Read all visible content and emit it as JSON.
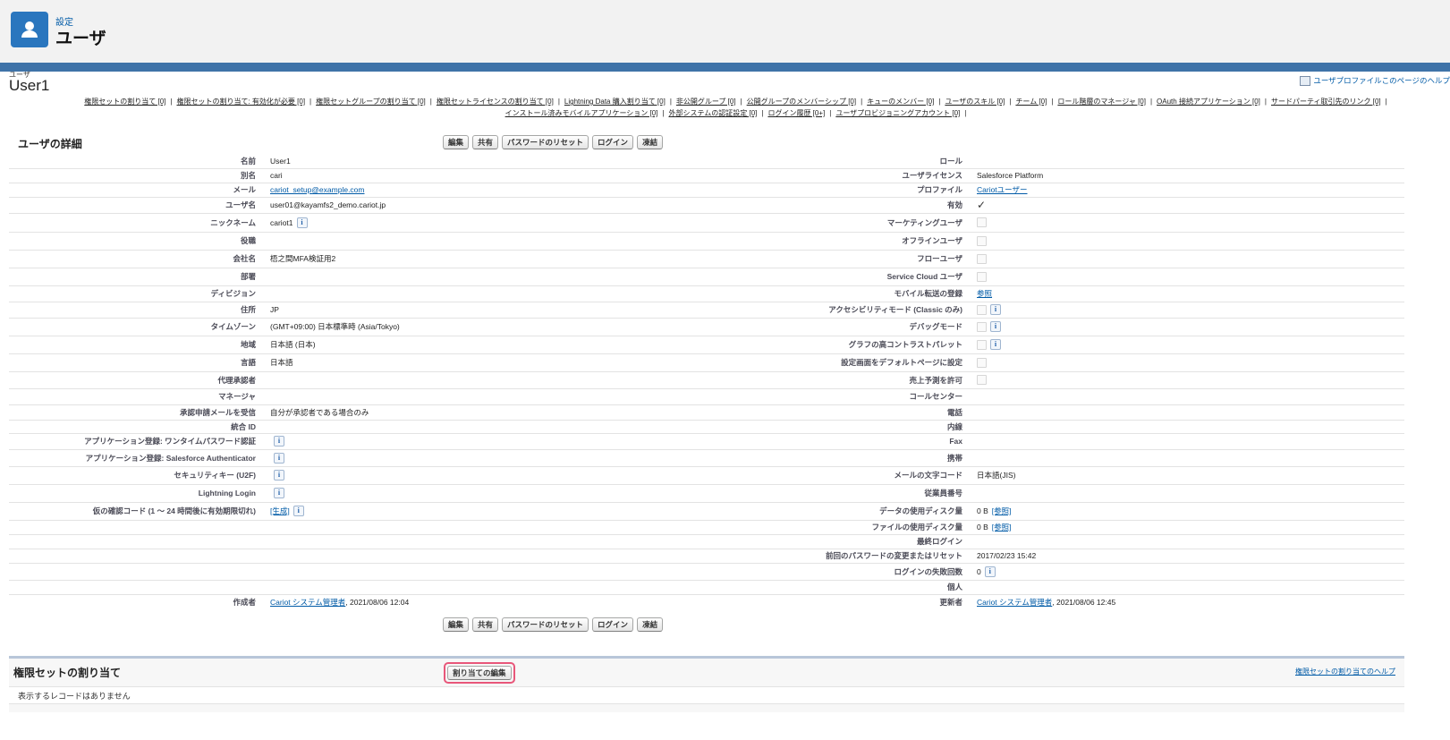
{
  "header": {
    "breadcrumb": "設定",
    "title": "ユーザ",
    "icon": "user-icon"
  },
  "user_header": {
    "small_label": "ユーザ",
    "name": "User1",
    "help_link": "ユーザプロファイルこのページのヘルプ"
  },
  "related_links_row1": [
    "権限セットの割り当て [0]",
    "権限セットの割り当て: 有効化が必要 [0]",
    "権限セットグループの割り当て [0]",
    "権限セットライセンスの割り当て [0]",
    "Lightning Data 購入割り当て [0]",
    "非公開グループ [0]",
    "公開グループのメンバーシップ [0]",
    "キューのメンバー [0]",
    "ユーザのスキル [0]",
    "チーム [0]",
    "ロール階層のマネージャ [0]",
    "OAuth 接続アプリケーション [0]",
    "サードパーティ取引先のリンク [0]"
  ],
  "related_links_row2": [
    "インストール済みモバイルアプリケーション [0]",
    "外部システムの認証設定 [0]",
    "ログイン履歴 [0+]",
    "ユーザプロビジョニングアカウント [0]"
  ],
  "detail": {
    "title": "ユーザの詳細",
    "buttons": [
      "編集",
      "共有",
      "パスワードのリセット",
      "ログイン",
      "凍結"
    ]
  },
  "left_fields": [
    {
      "label": "名前",
      "value": "User1"
    },
    {
      "label": "別名",
      "value": "cari"
    },
    {
      "label": "メール",
      "value": "cariot_setup@example.com",
      "link": true
    },
    {
      "label": "ユーザ名",
      "value": "user01@kayamfs2_demo.cariot.jp"
    },
    {
      "label": "ニックネーム",
      "value": "cariot1",
      "info": true
    },
    {
      "label": "役職",
      "value": ""
    },
    {
      "label": "会社名",
      "value": "梧之間MFA検証用2"
    },
    {
      "label": "部署",
      "value": ""
    },
    {
      "label": "ディビジョン",
      "value": ""
    },
    {
      "label": "住所",
      "value": "JP"
    },
    {
      "label": "タイムゾーン",
      "value": "(GMT+09:00) 日本標準時 (Asia/Tokyo)"
    },
    {
      "label": "地域",
      "value": "日本語 (日本)"
    },
    {
      "label": "言語",
      "value": "日本語"
    },
    {
      "label": "代理承認者",
      "value": ""
    },
    {
      "label": "マネージャ",
      "value": ""
    },
    {
      "label": "承認申請メールを受信",
      "value": "自分が承認者である場合のみ"
    },
    {
      "label": "統合 ID",
      "value": ""
    },
    {
      "label": "アプリケーション登録: ワンタイムパスワード認証",
      "value": "",
      "info": true
    },
    {
      "label": "アプリケーション登録: Salesforce Authenticator",
      "value": "",
      "info": true
    },
    {
      "label": "セキュリティキー (U2F)",
      "value": "",
      "info": true
    },
    {
      "label": "Lightning Login",
      "value": "",
      "info": true
    },
    {
      "label": "仮の確認コード (1 ～ 24 時間後に有効期限切れ)",
      "value": "[生成]",
      "link": true,
      "info": true
    }
  ],
  "right_fields": [
    {
      "label": "ロール",
      "value": ""
    },
    {
      "label": "ユーザライセンス",
      "value": "Salesforce Platform"
    },
    {
      "label": "プロファイル",
      "value": "Cariotユーザー",
      "link": true
    },
    {
      "label": "有効",
      "value": "✓",
      "kind": "check"
    },
    {
      "label": "マーケティングユーザ",
      "kind": "checkbox"
    },
    {
      "label": "オフラインユーザ",
      "kind": "checkbox"
    },
    {
      "label": "フローユーザ",
      "kind": "checkbox"
    },
    {
      "label": "Service Cloud ユーザ",
      "kind": "checkbox"
    },
    {
      "label": "モバイル転送の登録",
      "value": "参照",
      "link": true
    },
    {
      "label": "アクセシビリティモード (Classic のみ)",
      "kind": "checkbox",
      "info": true
    },
    {
      "label": "デバッグモード",
      "kind": "checkbox",
      "info": true
    },
    {
      "label": "グラフの高コントラストパレット",
      "kind": "checkbox",
      "info": true
    },
    {
      "label": "設定画面をデフォルトページに設定",
      "kind": "checkbox"
    },
    {
      "label": "売上予測を許可",
      "kind": "checkbox"
    },
    {
      "label": "コールセンター",
      "value": ""
    },
    {
      "label": "電話",
      "value": ""
    },
    {
      "label": "内線",
      "value": ""
    },
    {
      "label": "Fax",
      "value": ""
    },
    {
      "label": "携帯",
      "value": ""
    },
    {
      "label": "メールの文字コード",
      "value": "日本語(JIS)"
    },
    {
      "label": "従業員番号",
      "value": ""
    },
    {
      "label": "データの使用ディスク量",
      "value": "0 B",
      "link_value": "[参照]"
    },
    {
      "label": "ファイルの使用ディスク量",
      "value": "0 B",
      "link_value": "[参照]"
    },
    {
      "label": "最終ログイン",
      "value": ""
    },
    {
      "label": "前回のパスワードの変更またはリセット",
      "value": "2017/02/23 15:42"
    },
    {
      "label": "ログインの失敗回数",
      "value": "0",
      "info": true
    },
    {
      "label": "個人",
      "value": ""
    }
  ],
  "footer_row": {
    "created_label": "作成者",
    "created_link": "Cariot システム管理者",
    "created_date": ", 2021/08/06 12:04",
    "modified_label": "更新者",
    "modified_link": "Cariot システム管理者",
    "modified_date": ", 2021/08/06 12:45"
  },
  "perm_section": {
    "title": "権限セットの割り当て",
    "button": "割り当ての編集",
    "help": "権限セットの割り当てのヘルプ",
    "empty": "表示するレコードはありません"
  }
}
